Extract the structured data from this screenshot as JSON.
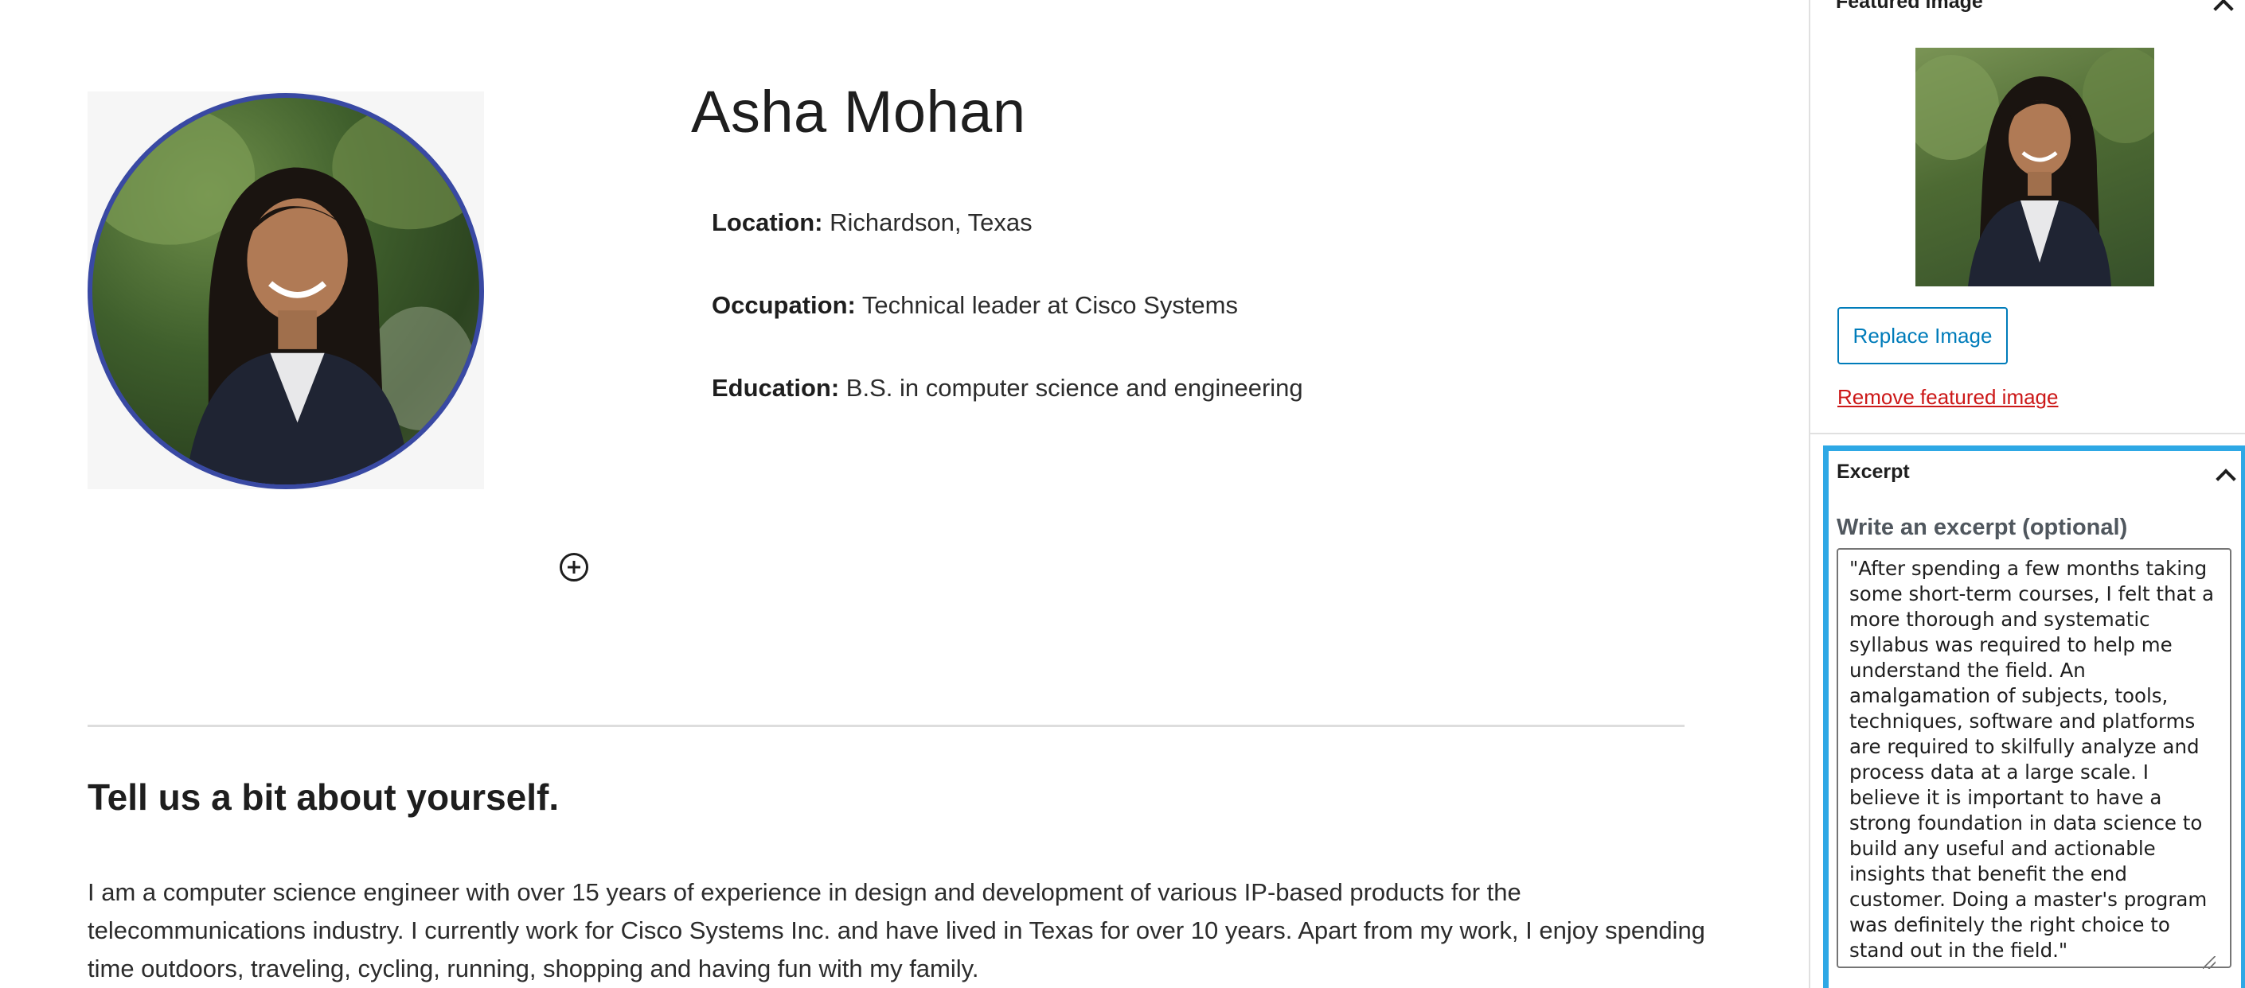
{
  "profile": {
    "name": "Asha Mohan",
    "location_label": "Location:",
    "location_value": "Richardson, Texas",
    "occupation_label": "Occupation:",
    "occupation_value": "Technical leader at Cisco Systems",
    "education_label": "Education:",
    "education_value": "B.S. in computer science and engineering"
  },
  "about": {
    "heading": "Tell us a bit about yourself.",
    "body": "I am a computer science engineer with over 15 years of experience in design and development of various IP-based products for the telecommunications industry. I currently work for Cisco Systems Inc. and have lived in Texas for over 10 years. Apart from my work, I enjoy spending time outdoors, traveling, cycling, running, shopping and having fun with my family."
  },
  "sidebar": {
    "featured_image": {
      "title": "Featured image",
      "replace_label": "Replace Image",
      "remove_label": "Remove featured image"
    },
    "excerpt": {
      "title": "Excerpt",
      "field_label": "Write an excerpt (optional)",
      "value": "\"After spending a few months taking some short-term courses, I felt that a more thorough and systematic syllabus was required to help me understand the field. An amalgamation of subjects, tools, techniques, software and platforms are required to skilfully analyze and process data at a large scale. I believe it is important to have a strong foundation in data science to build any useful and actionable insights that benefit the end customer. Doing a master's program was definitely the right choice to stand out in the field.\""
    }
  },
  "colors": {
    "accent": "#007cba",
    "focus_border": "#2ea8e5",
    "destructive": "#cc1818",
    "photo_ring": "#3949a3"
  },
  "icons": {
    "add_block": "plus-circle-icon",
    "collapse": "chevron-up-icon"
  }
}
